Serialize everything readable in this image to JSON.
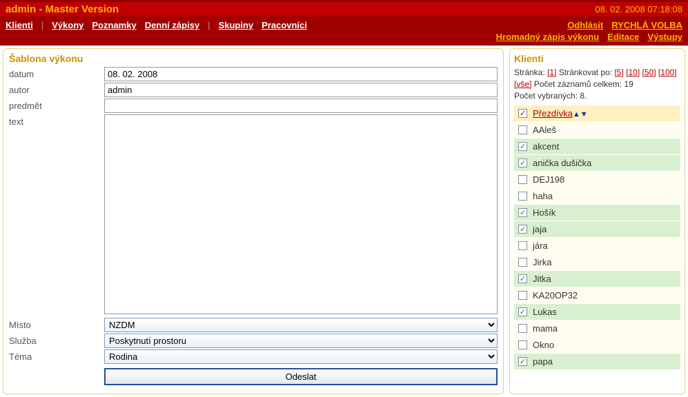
{
  "header": {
    "app_title": "admin - Master Version",
    "datetime": "08. 02. 2008 07:18:08"
  },
  "nav": {
    "left": [
      "Klienti",
      "Výkony",
      "Poznamky",
      "Denní zápisy",
      "Skupiny",
      "Pracovníci"
    ],
    "right_top": [
      "Odhlásit",
      "RYCHLÁ VOLBA"
    ],
    "right_bottom": [
      "Hromadný zápis výkonu",
      "Editace",
      "Výstupy"
    ]
  },
  "form": {
    "title": "Šablona výkonu",
    "labels": {
      "datum": "datum",
      "autor": "autor",
      "predmet": "predmět",
      "text": "text",
      "misto": "Místo",
      "sluzba": "Služba",
      "tema": "Téma"
    },
    "values": {
      "datum": "08. 02. 2008",
      "autor": "admin",
      "predmet": "",
      "text": "",
      "misto": "NZDM",
      "sluzba": "Poskytnutí prostoru",
      "tema": "Rodina"
    },
    "submit": "Odeslat"
  },
  "clients": {
    "title": "Klienti",
    "page_label": "Stránka:",
    "page_current": "[1]",
    "per_page_label": "Stránkovat po:",
    "per_page_options": [
      "[5]",
      "[10]",
      "[50]",
      "[100]"
    ],
    "all_label": "[vše]",
    "total_label": "Počet záznamů celkem:",
    "total_value": "19",
    "selected_label": "Počet vybraných:",
    "selected_value": "8.",
    "header_col": "Přezdívka",
    "sort_arrows": "▲▼",
    "rows": [
      {
        "name": "AAleš",
        "checked": false
      },
      {
        "name": "akcent",
        "checked": true
      },
      {
        "name": "anička dušička",
        "checked": true
      },
      {
        "name": "DEJ198",
        "checked": false
      },
      {
        "name": "haha",
        "checked": false
      },
      {
        "name": "Hošík",
        "checked": true
      },
      {
        "name": "jaja",
        "checked": true
      },
      {
        "name": "jára",
        "checked": false
      },
      {
        "name": "Jirka",
        "checked": false
      },
      {
        "name": "Jitka",
        "checked": true
      },
      {
        "name": "KA20OP32",
        "checked": false
      },
      {
        "name": "Lukas",
        "checked": true
      },
      {
        "name": "mama",
        "checked": false
      },
      {
        "name": "Okno",
        "checked": false
      },
      {
        "name": "papa",
        "checked": true
      }
    ]
  }
}
